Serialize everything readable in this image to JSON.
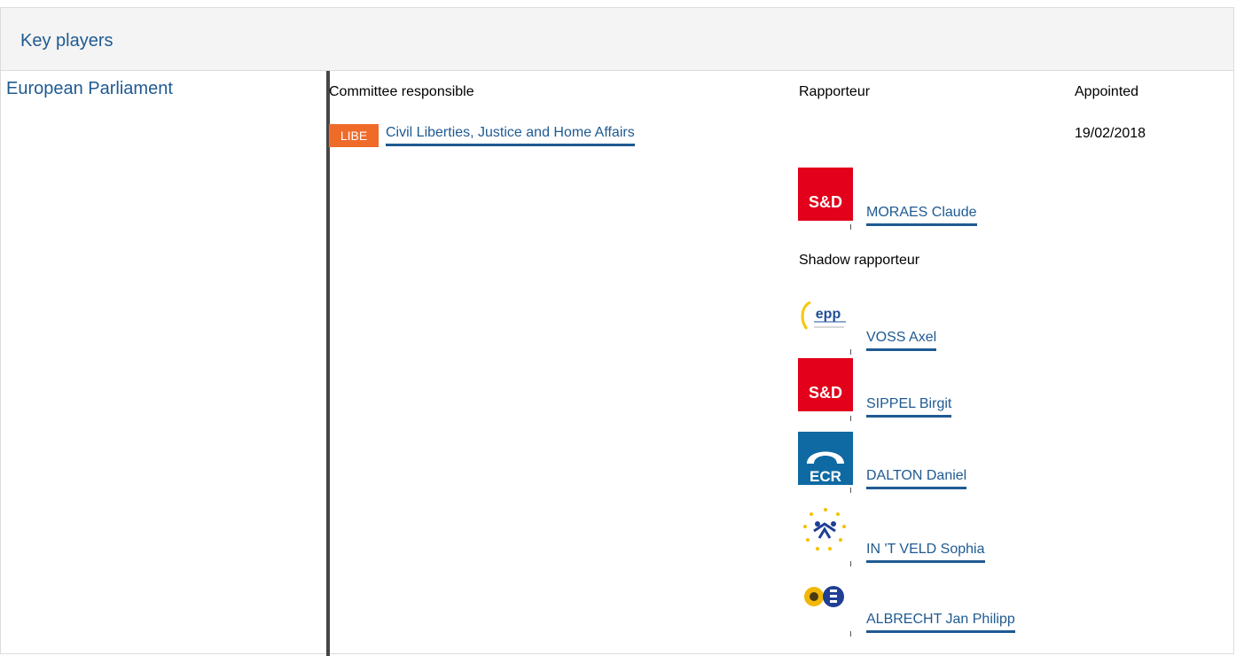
{
  "section": {
    "title": "Key players"
  },
  "institution": {
    "name": "European Parliament"
  },
  "columns": {
    "committee": "Committee responsible",
    "rapporteur": "Rapporteur",
    "appointed": "Appointed"
  },
  "committee": {
    "code": "LIBE",
    "name": "Civil Liberties, Justice and Home Affairs",
    "appointed_date": "19/02/2018"
  },
  "rapporteur": {
    "name": "MORAES Claude",
    "group_logo": "s&d-logo",
    "group_logo_text": "S&D"
  },
  "shadow_label": "Shadow rapporteur",
  "shadow_rapporteurs": [
    {
      "name": "VOSS Axel",
      "group_logo": "epp-logo",
      "group_logo_text": "epp"
    },
    {
      "name": "SIPPEL Birgit",
      "group_logo": "s&d-logo",
      "group_logo_text": "S&D"
    },
    {
      "name": "DALTON Daniel",
      "group_logo": "ecr-logo",
      "group_logo_text": "ECR"
    },
    {
      "name": "IN 'T VELD Sophia",
      "group_logo": "alde-logo"
    },
    {
      "name": "ALBRECHT Jan Philipp",
      "group_logo": "greens-efa-logo"
    }
  ],
  "colors": {
    "link": "#1f5a92",
    "badge": "#ef6b2a",
    "sd_red": "#e2001a",
    "ecr_blue": "#0f6aa3"
  }
}
